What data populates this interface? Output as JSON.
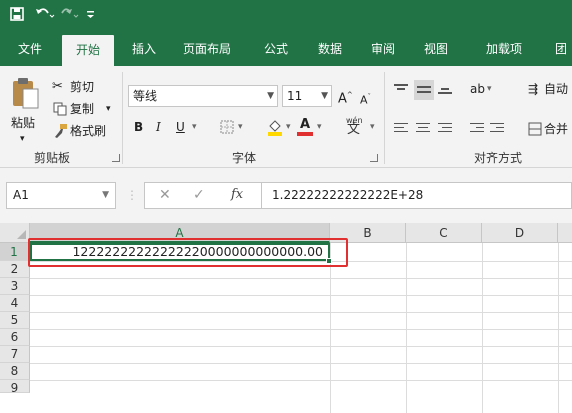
{
  "quick_access": {
    "save_icon": "save-icon",
    "undo_icon": "undo-icon",
    "redo_icon": "redo-icon",
    "customize_icon": "customize-qat-icon"
  },
  "tabs": [
    {
      "label": "文件"
    },
    {
      "label": "开始",
      "active": true
    },
    {
      "label": "插入"
    },
    {
      "label": "页面布局"
    },
    {
      "label": "公式"
    },
    {
      "label": "数据"
    },
    {
      "label": "审阅"
    },
    {
      "label": "视图"
    },
    {
      "label": "加载项"
    },
    {
      "label": "团"
    }
  ],
  "clipboard": {
    "paste": "粘贴",
    "cut": "剪切",
    "copy": "复制",
    "format_painter": "格式刷",
    "group_label": "剪贴板"
  },
  "font": {
    "name": "等线",
    "size": "11",
    "grow": "A",
    "shrink": "A",
    "bold": "B",
    "italic": "I",
    "underline": "U",
    "phonetic": "wén",
    "phonetic_char": "文",
    "group_label": "字体"
  },
  "alignment": {
    "wrap_text": "自动",
    "merge": "合并",
    "group_label": "对齐方式"
  },
  "formula_bar": {
    "name_box": "A1",
    "fx": "fx",
    "formula": "1.22222222222222E+28"
  },
  "grid": {
    "columns": [
      "A",
      "B",
      "C",
      "D"
    ],
    "rows": [
      "1",
      "2",
      "3",
      "4",
      "5",
      "6",
      "7",
      "8",
      "9"
    ],
    "a1_value": "12222222222222220000000000000.00"
  },
  "colors": {
    "accent": "#217346",
    "annotation": "#e0302f"
  }
}
